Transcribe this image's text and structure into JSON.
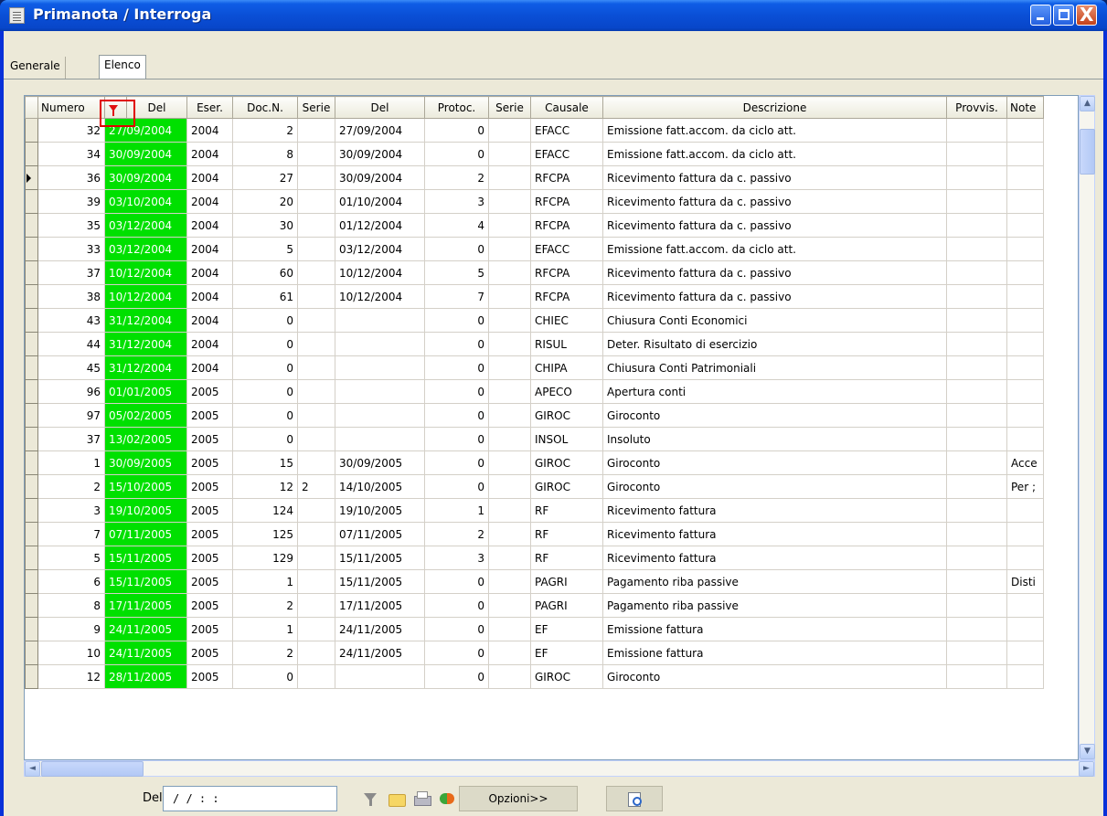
{
  "window": {
    "title": "Primanota / Interroga",
    "minimize_label": "_",
    "maximize_label": "□",
    "close_label": "X"
  },
  "tabs": [
    {
      "label": "Generale"
    },
    {
      "label": "Elenco"
    }
  ],
  "grid": {
    "headers": [
      "Numero",
      "",
      "Del",
      "Eser.",
      "Doc.N.",
      "Serie",
      "Del",
      "Protoc.",
      "Serie",
      "Causale",
      "Descrizione",
      "Provvis.",
      "Note"
    ],
    "sort_index": "1",
    "rows": [
      {
        "numero": "32",
        "del": "27/09/2004",
        "eser": "2004",
        "docn": "2",
        "serie": "",
        "del2": "27/09/2004",
        "protoc": "0",
        "serie2": "",
        "causale": "EFACC",
        "descrizione": "Emissione fatt.accom. da ciclo att.",
        "provvis": "",
        "note": ""
      },
      {
        "numero": "34",
        "del": "30/09/2004",
        "eser": "2004",
        "docn": "8",
        "serie": "",
        "del2": "30/09/2004",
        "protoc": "0",
        "serie2": "",
        "causale": "EFACC",
        "descrizione": "Emissione fatt.accom. da ciclo att.",
        "provvis": "",
        "note": ""
      },
      {
        "numero": "36",
        "del": "30/09/2004",
        "eser": "2004",
        "docn": "27",
        "serie": "",
        "del2": "30/09/2004",
        "protoc": "2",
        "serie2": "",
        "causale": "RFCPA",
        "descrizione": "Ricevimento fattura da c. passivo",
        "provvis": "",
        "note": "",
        "current": true
      },
      {
        "numero": "39",
        "del": "03/10/2004",
        "eser": "2004",
        "docn": "20",
        "serie": "",
        "del2": "01/10/2004",
        "protoc": "3",
        "serie2": "",
        "causale": "RFCPA",
        "descrizione": "Ricevimento fattura da c. passivo",
        "provvis": "",
        "note": ""
      },
      {
        "numero": "35",
        "del": "03/12/2004",
        "eser": "2004",
        "docn": "30",
        "serie": "",
        "del2": "01/12/2004",
        "protoc": "4",
        "serie2": "",
        "causale": "RFCPA",
        "descrizione": "Ricevimento fattura da c. passivo",
        "provvis": "",
        "note": ""
      },
      {
        "numero": "33",
        "del": "03/12/2004",
        "eser": "2004",
        "docn": "5",
        "serie": "",
        "del2": "03/12/2004",
        "protoc": "0",
        "serie2": "",
        "causale": "EFACC",
        "descrizione": "Emissione fatt.accom. da ciclo att.",
        "provvis": "",
        "note": ""
      },
      {
        "numero": "37",
        "del": "10/12/2004",
        "eser": "2004",
        "docn": "60",
        "serie": "",
        "del2": "10/12/2004",
        "protoc": "5",
        "serie2": "",
        "causale": "RFCPA",
        "descrizione": "Ricevimento fattura da c. passivo",
        "provvis": "",
        "note": ""
      },
      {
        "numero": "38",
        "del": "10/12/2004",
        "eser": "2004",
        "docn": "61",
        "serie": "",
        "del2": "10/12/2004",
        "protoc": "7",
        "serie2": "",
        "causale": "RFCPA",
        "descrizione": "Ricevimento fattura da c. passivo",
        "provvis": "",
        "note": ""
      },
      {
        "numero": "43",
        "del": "31/12/2004",
        "eser": "2004",
        "docn": "0",
        "serie": "",
        "del2": "",
        "protoc": "0",
        "serie2": "",
        "causale": "CHIEC",
        "descrizione": "Chiusura Conti Economici",
        "provvis": "",
        "note": ""
      },
      {
        "numero": "44",
        "del": "31/12/2004",
        "eser": "2004",
        "docn": "0",
        "serie": "",
        "del2": "",
        "protoc": "0",
        "serie2": "",
        "causale": "RISUL",
        "descrizione": "Deter. Risultato di esercizio",
        "provvis": "",
        "note": ""
      },
      {
        "numero": "45",
        "del": "31/12/2004",
        "eser": "2004",
        "docn": "0",
        "serie": "",
        "del2": "",
        "protoc": "0",
        "serie2": "",
        "causale": "CHIPA",
        "descrizione": "Chiusura Conti Patrimoniali",
        "provvis": "",
        "note": ""
      },
      {
        "numero": "96",
        "del": "01/01/2005",
        "eser": "2005",
        "docn": "0",
        "serie": "",
        "del2": "",
        "protoc": "0",
        "serie2": "",
        "causale": "APECO",
        "descrizione": "Apertura conti",
        "provvis": "",
        "note": ""
      },
      {
        "numero": "97",
        "del": "05/02/2005",
        "eser": "2005",
        "docn": "0",
        "serie": "",
        "del2": "",
        "protoc": "0",
        "serie2": "",
        "causale": "GIROC",
        "descrizione": "Giroconto",
        "provvis": "",
        "note": ""
      },
      {
        "numero": "37",
        "del": "13/02/2005",
        "eser": "2005",
        "docn": "0",
        "serie": "",
        "del2": "",
        "protoc": "0",
        "serie2": "",
        "causale": "INSOL",
        "descrizione": "Insoluto",
        "provvis": "",
        "note": ""
      },
      {
        "numero": "1",
        "del": "30/09/2005",
        "eser": "2005",
        "docn": "15",
        "serie": "",
        "del2": "30/09/2005",
        "protoc": "0",
        "serie2": "",
        "causale": "GIROC",
        "descrizione": "Giroconto",
        "provvis": "",
        "note": "Acce"
      },
      {
        "numero": "2",
        "del": "15/10/2005",
        "eser": "2005",
        "docn": "12",
        "serie": "2",
        "del2": "14/10/2005",
        "protoc": "0",
        "serie2": "",
        "causale": "GIROC",
        "descrizione": "Giroconto",
        "provvis": "",
        "note": "Per ;"
      },
      {
        "numero": "3",
        "del": "19/10/2005",
        "eser": "2005",
        "docn": "124",
        "serie": "",
        "del2": "19/10/2005",
        "protoc": "1",
        "serie2": "",
        "causale": "RF",
        "descrizione": "Ricevimento fattura",
        "provvis": "",
        "note": ""
      },
      {
        "numero": "7",
        "del": "07/11/2005",
        "eser": "2005",
        "docn": "125",
        "serie": "",
        "del2": "07/11/2005",
        "protoc": "2",
        "serie2": "",
        "causale": "RF",
        "descrizione": "Ricevimento fattura",
        "provvis": "",
        "note": ""
      },
      {
        "numero": "5",
        "del": "15/11/2005",
        "eser": "2005",
        "docn": "129",
        "serie": "",
        "del2": "15/11/2005",
        "protoc": "3",
        "serie2": "",
        "causale": "RF",
        "descrizione": "Ricevimento fattura",
        "provvis": "",
        "note": ""
      },
      {
        "numero": "6",
        "del": "15/11/2005",
        "eser": "2005",
        "docn": "1",
        "serie": "",
        "del2": "15/11/2005",
        "protoc": "0",
        "serie2": "",
        "causale": "PAGRI",
        "descrizione": "Pagamento riba passive",
        "provvis": "",
        "note": "Disti"
      },
      {
        "numero": "8",
        "del": "17/11/2005",
        "eser": "2005",
        "docn": "2",
        "serie": "",
        "del2": "17/11/2005",
        "protoc": "0",
        "serie2": "",
        "causale": "PAGRI",
        "descrizione": "Pagamento riba passive",
        "provvis": "",
        "note": ""
      },
      {
        "numero": "9",
        "del": "24/11/2005",
        "eser": "2005",
        "docn": "1",
        "serie": "",
        "del2": "24/11/2005",
        "protoc": "0",
        "serie2": "",
        "causale": "EF",
        "descrizione": "Emissione fattura",
        "provvis": "",
        "note": ""
      },
      {
        "numero": "10",
        "del": "24/11/2005",
        "eser": "2005",
        "docn": "2",
        "serie": "",
        "del2": "24/11/2005",
        "protoc": "0",
        "serie2": "",
        "causale": "EF",
        "descrizione": "Emissione fattura",
        "provvis": "",
        "note": ""
      },
      {
        "numero": "12",
        "del": "28/11/2005",
        "eser": "2005",
        "docn": "0",
        "serie": "",
        "del2": "",
        "protoc": "0",
        "serie2": "",
        "causale": "GIROC",
        "descrizione": "Giroconto",
        "provvis": "",
        "note": ""
      }
    ]
  },
  "scroll": {
    "up": "▲",
    "down": "▼",
    "left": "◄",
    "right": "►"
  },
  "bottom": {
    "del_label": "Del",
    "del_value": "/ /    : :",
    "opzioni_label": "Opzioni>>"
  },
  "colors": {
    "date_highlight": "#00e000",
    "filter_box": "#e00000",
    "titlebar": "#0a4fd6"
  },
  "icons": [
    "filter-icon",
    "folder-icon",
    "print-icon",
    "refresh-icon",
    "preview-icon"
  ]
}
